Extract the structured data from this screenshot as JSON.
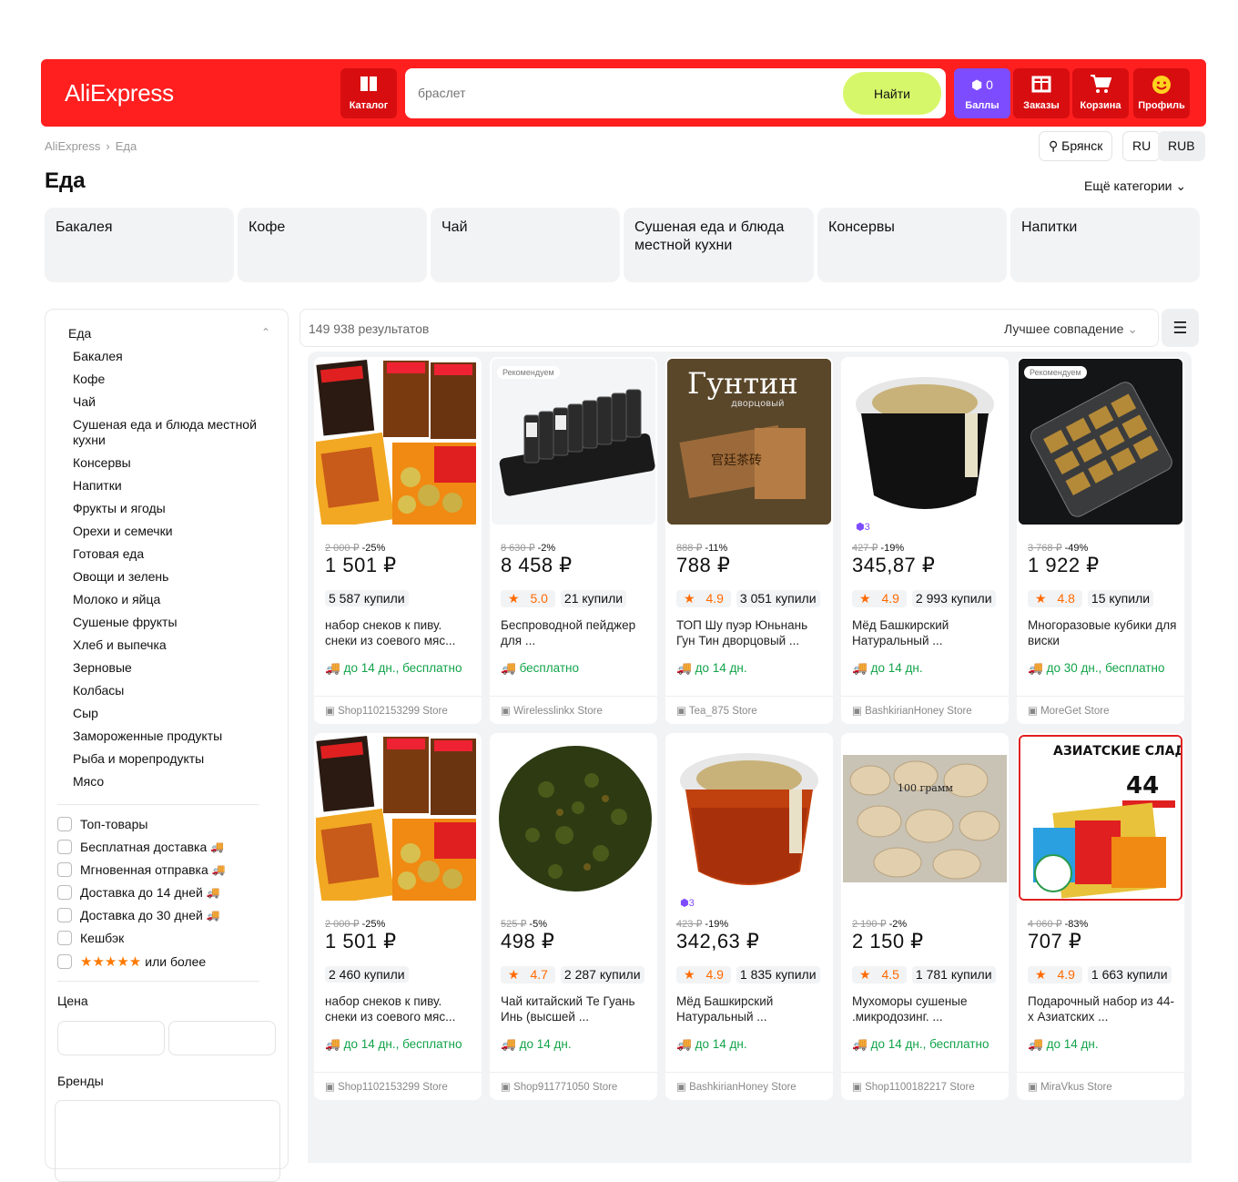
{
  "header": {
    "logo": "AliExpress",
    "catalog": "Каталог",
    "search_placeholder": "браслет",
    "search_button": "Найти",
    "points_value": "0",
    "points_label": "Баллы",
    "orders": "Заказы",
    "cart": "Корзина",
    "profile": "Профиль"
  },
  "breadcrumb": [
    "AliExpress",
    "Еда"
  ],
  "location": {
    "city": "Брянск",
    "lang": "RU",
    "currency": "RUB"
  },
  "page_title": "Еда",
  "more_categories": "Ещё категории",
  "top_categories": [
    "Бакалея",
    "Кофе",
    "Чай",
    "Сушеная еда и блюда местной кухни",
    "Консервы",
    "Напитки"
  ],
  "sidebar": {
    "section": "Еда",
    "items": [
      "Бакалея",
      "Кофе",
      "Чай",
      "Сушеная еда и блюда местной кухни",
      "Консервы",
      "Напитки",
      "Фрукты и ягоды",
      "Орехи и семечки",
      "Готовая еда",
      "Овощи и зелень",
      "Молоко и яйца",
      "Сушеные фрукты",
      "Хлеб и выпечка",
      "Зерновые",
      "Колбасы",
      "Сыр",
      "Замороженные продукты",
      "Рыба и морепродукты",
      "Мясо"
    ],
    "filters": [
      "Топ-товары",
      "Бесплатная доставка",
      "Мгновенная отправка",
      "Доставка до 14 дней",
      "Доставка до 30 дней",
      "Кешбэк",
      "или более"
    ],
    "price_label": "Цена",
    "brands_label": "Бренды"
  },
  "results": {
    "count": "149 938 результатов",
    "sort": "Лучшее совпадение"
  },
  "products": [
    {
      "old": "2 000 ₽",
      "disc": "-25%",
      "price": "1 501 ₽",
      "rating": "",
      "sold": "5 587 купили",
      "name": "набор снеков к пиву. снеки из соевого мяс...",
      "delivery": "до 14 дн., бесплатно",
      "store": "Shop1102153299 Store",
      "badge": ""
    },
    {
      "old": "8 630 ₽",
      "disc": "-2%",
      "price": "8 458 ₽",
      "rating": "5.0",
      "sold": "21 купили",
      "name": "Беспроводной пейджер для ...",
      "delivery": "бесплатно",
      "store": "Wirelesslinkx Store",
      "badge": "Рекомендуем"
    },
    {
      "old": "888 ₽",
      "disc": "-11%",
      "price": "788 ₽",
      "rating": "4.9",
      "sold": "3 051 купили",
      "name": "ТОП Шу пуэр Юньнань Гун Тин дворцовый ...",
      "delivery": "до 14 дн.",
      "store": "Tea_875 Store",
      "badge": ""
    },
    {
      "old": "427 ₽",
      "disc": "-19%",
      "price": "345,87 ₽",
      "rating": "4.9",
      "sold": "2 993 купили",
      "name": "Мёд Башкирский Натуральный ...",
      "delivery": "до 14 дн.",
      "store": "BashkirianHoney Store",
      "badge": "",
      "coins": "3"
    },
    {
      "old": "3 768 ₽",
      "disc": "-49%",
      "price": "1 922 ₽",
      "rating": "4.8",
      "sold": "15 купили",
      "name": "Многоразовые кубики для виски",
      "delivery": "до 30 дн., бесплатно",
      "store": "MoreGet Store",
      "badge": "Рекомендуем"
    },
    {
      "old": "2 000 ₽",
      "disc": "-25%",
      "price": "1 501 ₽",
      "rating": "",
      "sold": "2 460 купили",
      "name": "набор снеков к пиву. снеки из соевого мяс...",
      "delivery": "до 14 дн., бесплатно",
      "store": "Shop1102153299 Store",
      "badge": ""
    },
    {
      "old": "525 ₽",
      "disc": "-5%",
      "price": "498 ₽",
      "rating": "4.7",
      "sold": "2 287 купили",
      "name": "Чай китайский Те Гуань Инь (высшей ...",
      "delivery": "до 14 дн.",
      "store": "Shop911771050 Store",
      "badge": ""
    },
    {
      "old": "423 ₽",
      "disc": "-19%",
      "price": "342,63 ₽",
      "rating": "4.9",
      "sold": "1 835 купили",
      "name": "Мёд Башкирский Натуральный ...",
      "delivery": "до 14 дн.",
      "store": "BashkirianHoney Store",
      "badge": "",
      "coins": "3"
    },
    {
      "old": "2 190 ₽",
      "disc": "-2%",
      "price": "2 150 ₽",
      "rating": "4.5",
      "sold": "1 781 купили",
      "name": "Мухоморы сушеные .микродозинг. ...",
      "delivery": "до 14 дн., бесплатно",
      "store": "Shop1100182217 Store",
      "badge": ""
    },
    {
      "old": "4 060 ₽",
      "disc": "-83%",
      "price": "707 ₽",
      "rating": "4.9",
      "sold": "1 663 купили",
      "name": "Подарочный набор из 44-х Азиатских ...",
      "delivery": "до 14 дн.",
      "store": "MiraVkus Store",
      "badge": ""
    }
  ],
  "image_text": {
    "tea_title": "Гунтин",
    "tea_sub": "дворцовый",
    "honey_weight": "100 грамм",
    "asian_title": "АЗИАТСКИЕ СЛАДОСТИ",
    "asian_num": "44"
  }
}
